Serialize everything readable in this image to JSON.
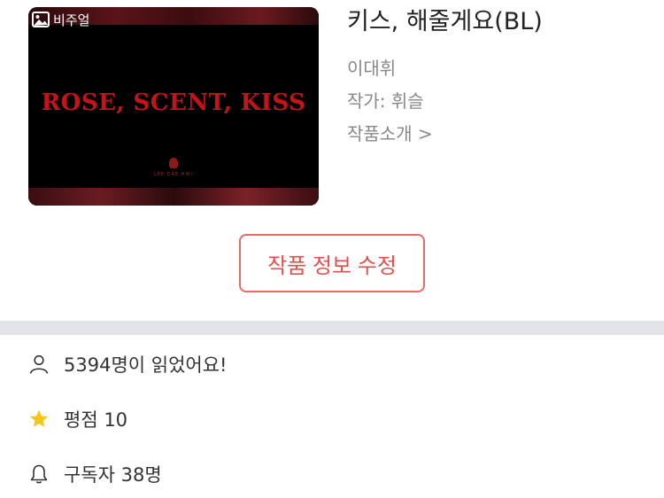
{
  "cover": {
    "badge_label": "비주얼",
    "art_text": "ROSE, SCENT, KISS",
    "art_subtext": "LEE DAE HWI"
  },
  "work": {
    "title": "키스, 해줄게요(BL)",
    "author": "이대휘",
    "artist": "작가: 휘슬",
    "intro_link": "작품소개 >"
  },
  "edit_button_label": "작품 정보 수정",
  "stats": {
    "readers": "5394명이 읽었어요!",
    "rating": "평점 10",
    "subscribers": "구독자 38명"
  },
  "colors": {
    "accent": "#e0504f",
    "star": "#f5c518",
    "divider": "#e2e4e8"
  }
}
